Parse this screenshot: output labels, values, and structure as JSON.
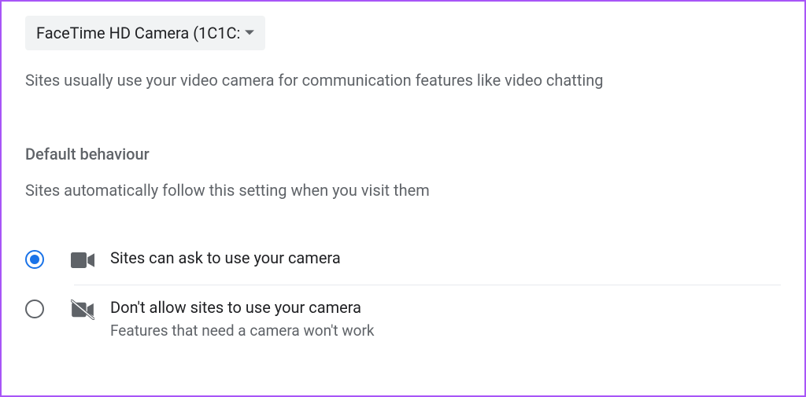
{
  "camera_select": {
    "label": "FaceTime HD Camera (1C1C:"
  },
  "description": "Sites usually use your video camera for communication features like video chatting",
  "section": {
    "heading": "Default behaviour",
    "subtext": "Sites automatically follow this setting when you visit them"
  },
  "options": {
    "allow": {
      "title": "Sites can ask to use your camera"
    },
    "block": {
      "title": "Don't allow sites to use your camera",
      "sub": "Features that need a camera won't work"
    }
  }
}
